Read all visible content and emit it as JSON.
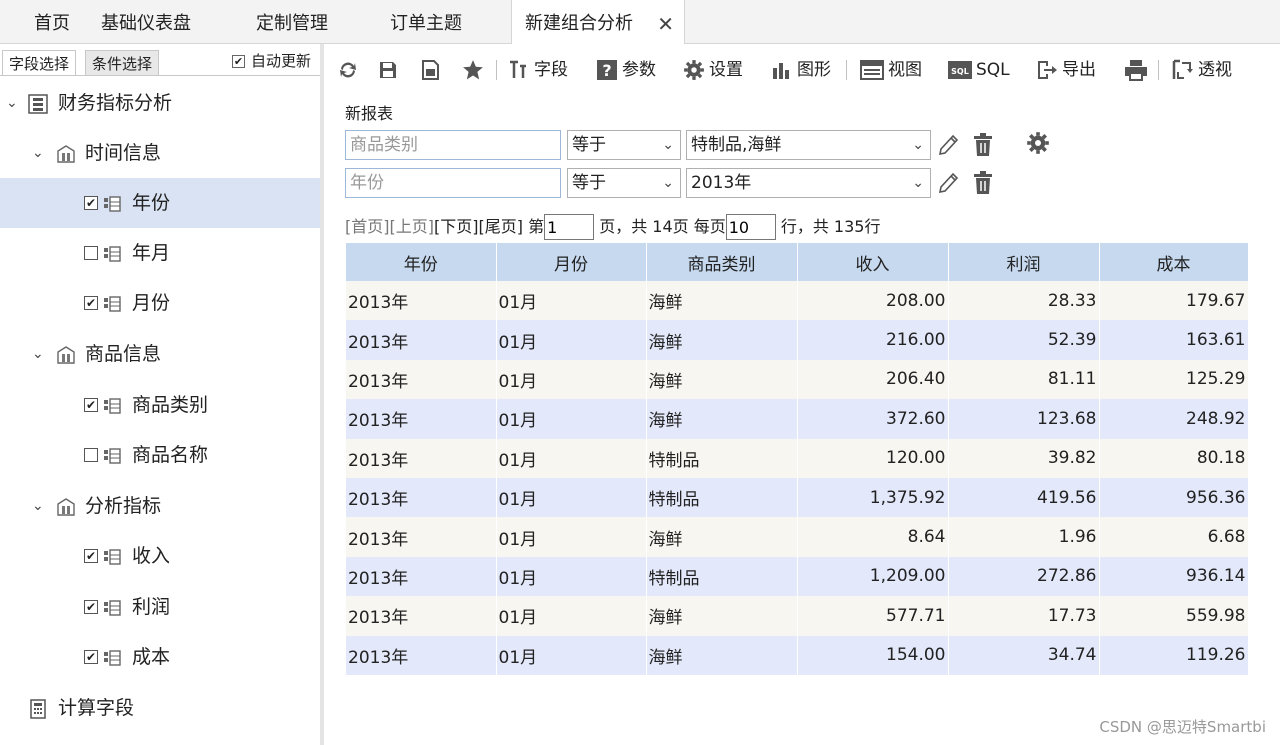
{
  "tabs": [
    {
      "label": "首页"
    },
    {
      "label": "基础仪表盘"
    },
    {
      "label": "定制管理"
    },
    {
      "label": "订单主题"
    },
    {
      "label": "新建组合分析",
      "active": true
    }
  ],
  "left_panel": {
    "tab_fields": "字段选择",
    "tab_conditions": "条件选择",
    "auto_update": "自动更新",
    "tree": {
      "root": "财务指标分析",
      "group_time": "时间信息",
      "year": "年份",
      "year_month": "年月",
      "month": "月份",
      "group_product": "商品信息",
      "category": "商品类别",
      "product_name": "商品名称",
      "group_metrics": "分析指标",
      "revenue": "收入",
      "profit": "利润",
      "cost": "成本",
      "calc_fields": "计算字段"
    }
  },
  "toolbar": {
    "field": "字段",
    "param": "参数",
    "settings": "设置",
    "chart": "图形",
    "view": "视图",
    "sql": "SQL",
    "sql_badge": "SQL",
    "export": "导出",
    "pivot": "透视"
  },
  "report_title": "新报表",
  "conditions": [
    {
      "field": "商品类别",
      "op": "等于",
      "value": "特制品,海鲜"
    },
    {
      "field": "年份",
      "op": "等于",
      "value": "2013年"
    }
  ],
  "pager": {
    "first": "[首页]",
    "prev": "[上页]",
    "next": "[下页]",
    "last": "[尾页]",
    "page_prefix": "第",
    "page": "1",
    "page_suffix": "页，共 14页 每页",
    "per_page": "10",
    "rows_suffix": "行，共 135行"
  },
  "table": {
    "headers": [
      "年份",
      "月份",
      "商品类别",
      "收入",
      "利润",
      "成本"
    ],
    "rows": [
      [
        "2013年",
        "01月",
        "海鲜",
        "208.00",
        "28.33",
        "179.67"
      ],
      [
        "2013年",
        "01月",
        "海鲜",
        "216.00",
        "52.39",
        "163.61"
      ],
      [
        "2013年",
        "01月",
        "海鲜",
        "206.40",
        "81.11",
        "125.29"
      ],
      [
        "2013年",
        "01月",
        "海鲜",
        "372.60",
        "123.68",
        "248.92"
      ],
      [
        "2013年",
        "01月",
        "特制品",
        "120.00",
        "39.82",
        "80.18"
      ],
      [
        "2013年",
        "01月",
        "特制品",
        "1,375.92",
        "419.56",
        "956.36"
      ],
      [
        "2013年",
        "01月",
        "海鲜",
        "8.64",
        "1.96",
        "6.68"
      ],
      [
        "2013年",
        "01月",
        "特制品",
        "1,209.00",
        "272.86",
        "936.14"
      ],
      [
        "2013年",
        "01月",
        "海鲜",
        "577.71",
        "17.73",
        "559.98"
      ],
      [
        "2013年",
        "01月",
        "海鲜",
        "154.00",
        "34.74",
        "119.26"
      ]
    ]
  },
  "watermark": "CSDN @思迈特Smartbi",
  "colors": {
    "header_bg": "#c7d9ef",
    "row_odd": "#f8f6f1",
    "row_even": "#e3e8fa",
    "selected": "#d9e3f3"
  }
}
